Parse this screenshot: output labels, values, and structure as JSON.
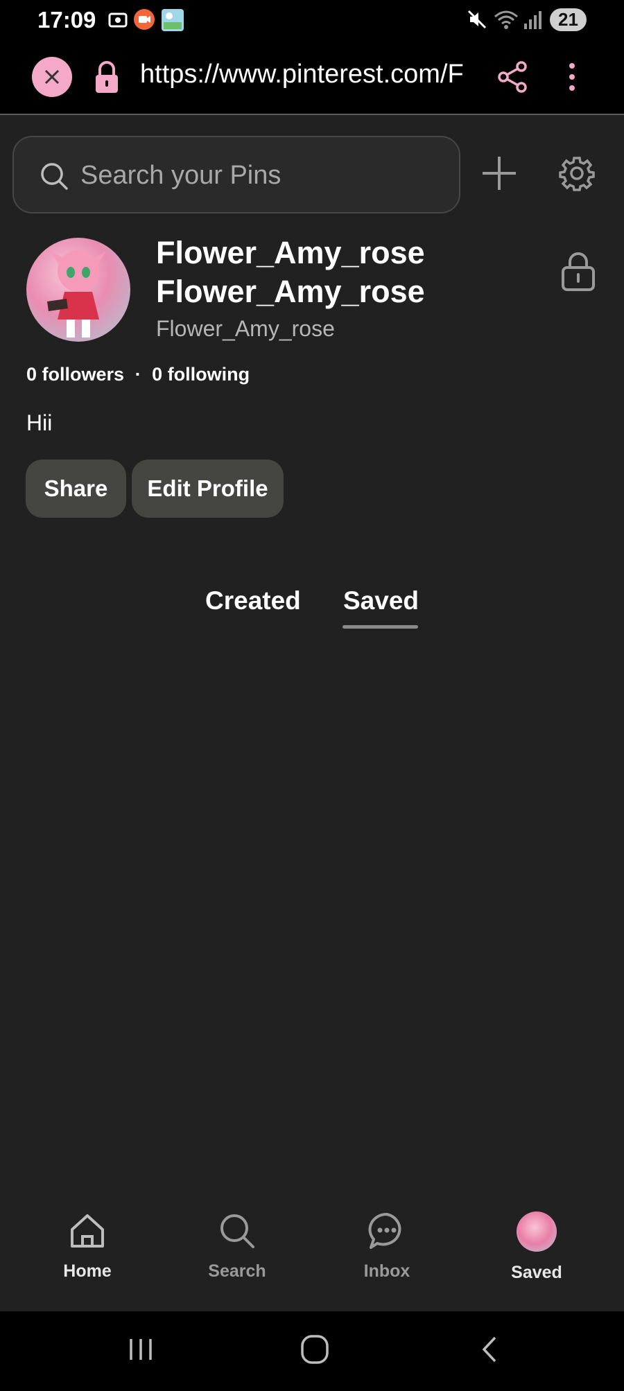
{
  "colors": {
    "background": "#212121",
    "status_bar": "#000000",
    "accent_pink": "#f3a9c7",
    "pill_background": "#454542",
    "muted_text": "#b6b6b6"
  },
  "status_bar": {
    "time": "17:09",
    "battery": "21",
    "icons": [
      "screenshot-icon",
      "recorder-icon",
      "gallery-icon",
      "mute-icon",
      "wifi-icon",
      "signal-icon"
    ]
  },
  "browser": {
    "url": "https://www.pinterest.com/F",
    "icons": [
      "close-icon",
      "lock-icon",
      "share-icon",
      "more-vert-icon"
    ]
  },
  "search": {
    "placeholder": "Search your Pins"
  },
  "profile": {
    "display_name": "Flower_Amy_rose Flower_Amy_rose",
    "username": "Flower_Amy_rose",
    "followers": "0 followers",
    "separator": "·",
    "following": "0 following",
    "bio": "Hii"
  },
  "actions": {
    "share_label": "Share",
    "edit_label": "Edit Profile"
  },
  "tabs": [
    {
      "label": "Created",
      "active": false
    },
    {
      "label": "Saved",
      "active": true
    }
  ],
  "bottom_nav": [
    {
      "label": "Home",
      "icon": "home-icon"
    },
    {
      "label": "Search",
      "icon": "search-icon"
    },
    {
      "label": "Inbox",
      "icon": "chat-icon"
    },
    {
      "label": "Saved",
      "icon": "avatar"
    }
  ],
  "system_nav": [
    "recents-icon",
    "home-circle-icon",
    "back-icon"
  ]
}
